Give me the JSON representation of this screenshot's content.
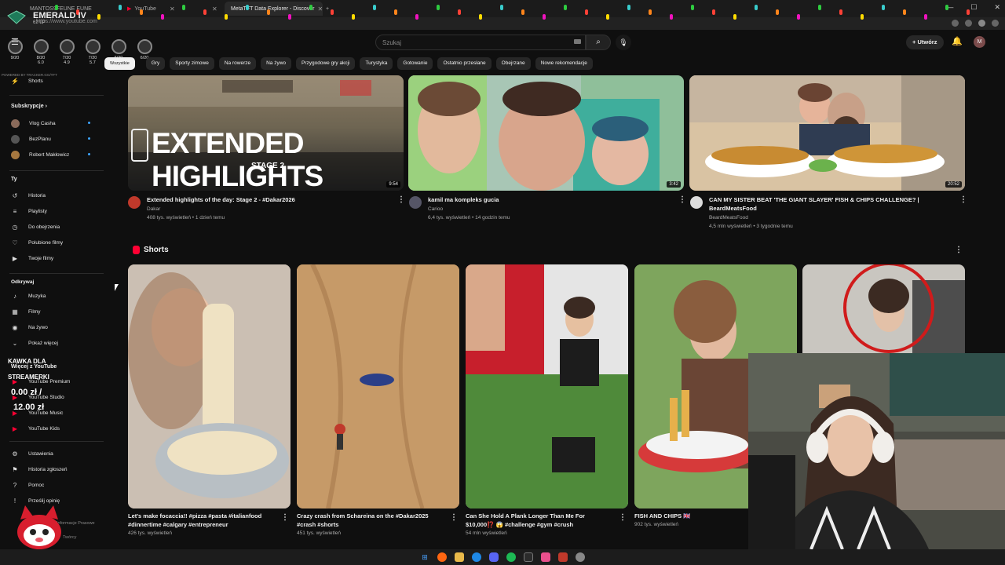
{
  "browser": {
    "tabs": [
      {
        "label": "MANTOS9FEUNE EUNE",
        "active": false
      },
      {
        "label": "YouTube",
        "active": false
      },
      {
        "label": "",
        "active": false
      },
      {
        "label": "",
        "active": false
      },
      {
        "label": "MetaTFT Data Explorer - Discover",
        "active": true
      }
    ],
    "new_tab": "+",
    "url": "https://www.youtube.com"
  },
  "overlay": {
    "rank": "EMERALD IV",
    "rank_sub": "62 LP",
    "placements": [
      {
        "label": "9/20",
        "sub": ""
      },
      {
        "label": "8/20",
        "sub": "6.0"
      },
      {
        "label": "7/20",
        "sub": "4.9"
      },
      {
        "label": "7/20",
        "sub": "5.7"
      },
      {
        "label": "6/20",
        "sub": ""
      },
      {
        "label": "6/20",
        "sub": ""
      }
    ],
    "powered": "POWERED BY TRACKER.GG/TFT",
    "kawka_line1": "KAWKA DLA",
    "kawka_line2": "STREAMERKI",
    "money_current": "0.00 zł /",
    "money_goal": "12.00 zł"
  },
  "header": {
    "search_placeholder": "Szukaj",
    "create_label": "Utwórz",
    "avatar_letter": "M"
  },
  "chips": [
    "Wszystkie",
    "Gry",
    "Sporty zimowe",
    "Na rowerze",
    "Na żywo",
    "Przygodowe gry akcji",
    "Turystyka",
    "Gotowanie",
    "Ostatnio przesłane",
    "Obejrzane",
    "Nowe rekomendacje"
  ],
  "sidebar": {
    "shorts": "Shorts",
    "subs_heading": "Subskrypcje",
    "subs": [
      {
        "label": "Vlog Casha",
        "color": "#8a6a5a"
      },
      {
        "label": "BezPlanu",
        "color": "#555555"
      },
      {
        "label": "Robert Makłowicz",
        "color": "#a5773f"
      }
    ],
    "you_heading": "Ty",
    "you_items": [
      {
        "label": "Historia",
        "icon": "history-icon",
        "glyph": "↺"
      },
      {
        "label": "Playlisty",
        "icon": "playlist-icon",
        "glyph": "≡"
      },
      {
        "label": "Do obejrzenia",
        "icon": "clock-icon",
        "glyph": "◷"
      },
      {
        "label": "Polubione filmy",
        "icon": "thumbs-up-icon",
        "glyph": "♡"
      },
      {
        "label": "Twoje filmy",
        "icon": "your-videos-icon",
        "glyph": "▶"
      }
    ],
    "explore_heading": "Odkrywaj",
    "explore_items": [
      {
        "label": "Muzyka",
        "icon": "music-icon",
        "glyph": "♪"
      },
      {
        "label": "Filmy",
        "icon": "film-icon",
        "glyph": "▦"
      },
      {
        "label": "Na żywo",
        "icon": "live-icon",
        "glyph": "◉"
      },
      {
        "label": "Pokaż więcej",
        "icon": "chevron-down-icon",
        "glyph": "⌄"
      }
    ],
    "more_heading": "Więcej z YouTube",
    "more_items": [
      {
        "label": "YouTube Premium"
      },
      {
        "label": "YouTube Studio"
      },
      {
        "label": "YouTube Music"
      },
      {
        "label": "YouTube Kids"
      }
    ],
    "bottom_items": [
      {
        "label": "Ustawienia",
        "icon": "gear-icon",
        "glyph": "⚙"
      },
      {
        "label": "Historia zgłoszeń",
        "icon": "flag-icon",
        "glyph": "⚑"
      },
      {
        "label": "Pomoc",
        "icon": "help-icon",
        "glyph": "?"
      },
      {
        "label": "Prześlij opinię",
        "icon": "feedback-icon",
        "glyph": "!"
      }
    ],
    "footer_1": "Informacje  Prasowe",
    "footer_2": "Twórcy"
  },
  "videos": [
    {
      "title": "Extended highlights of the day: Stage 2 - #Dakar2026",
      "channel": "Dakar",
      "meta": "408 tys. wyświetleń • 1 dzień temu",
      "duration": "9:54",
      "thumb_text": "EXTENDED HIGHLIGHTS",
      "thumb_sub": "STAGE 2"
    },
    {
      "title": "kamil ma kompleks gucia",
      "channel": "Carioo",
      "meta": "6,4 tys. wyświetleń • 14 godzin temu",
      "duration": "3:42"
    },
    {
      "title": "CAN MY SISTER BEAT 'THE GIANT SLAYER' FISH & CHIPS CHALLENGE? |",
      "title2": "BeardMeatsFood",
      "channel": "BeardMeatsFood",
      "meta": "4,5 mln wyświetleń • 3 tygodnie temu",
      "duration": "20:52"
    }
  ],
  "shorts_section": {
    "title": "Shorts",
    "items": [
      {
        "title": "Let's make focaccia!! #pizza #pasta #italianfood",
        "title2": "#dinnertime #calgary #entrepreneur",
        "meta": "426 tys. wyświetleń"
      },
      {
        "title": "Crazy crash from Schareina on the #Dakar2025",
        "title2": "#crash #shorts",
        "meta": "451 tys. wyświetleń"
      },
      {
        "title": "Can She Hold A Plank Longer Than Me For",
        "title2": "$10,000⁉️ 😱 #challenge #gym #crush",
        "meta": "54 mln wyświetleń"
      },
      {
        "title": "FISH AND CHIPS 🇬🇧",
        "title2": "",
        "meta": "902 tys. wyświetleń"
      },
      {
        "title": "",
        "title2": "",
        "meta": ""
      }
    ]
  },
  "colors": {
    "bg": "#0f0f0f",
    "accent_red": "#ff0033",
    "link_blue": "#3ea6ff"
  }
}
